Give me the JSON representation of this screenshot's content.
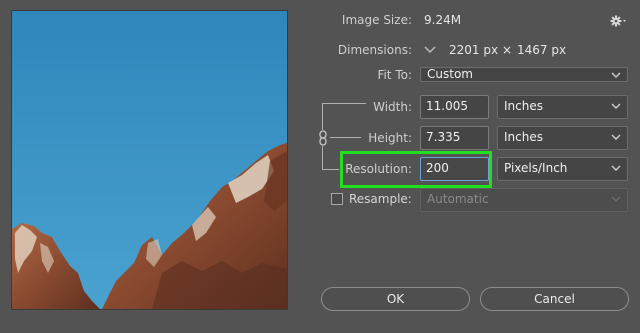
{
  "image_size": {
    "label": "Image Size:",
    "value": "9.24M"
  },
  "dimensions": {
    "label": "Dimensions:",
    "width": "2201 px",
    "times": "×",
    "height": "1467 px"
  },
  "fit_to": {
    "label": "Fit To:",
    "value": "Custom"
  },
  "width": {
    "label": "Width:",
    "value": "11.005",
    "unit": "Inches"
  },
  "height": {
    "label": "Height:",
    "value": "7.335",
    "unit": "Inches"
  },
  "resolution": {
    "label": "Resolution:",
    "value": "200",
    "unit": "Pixels/Inch"
  },
  "resample": {
    "label": "Resample:",
    "value": "Automatic",
    "checked": false
  },
  "buttons": {
    "ok": "OK",
    "cancel": "Cancel"
  },
  "icons": {
    "settings": "gear-icon",
    "constrain": "link-icon",
    "dimensions_dropdown": "chevron-down-icon"
  },
  "colors": {
    "highlight": "#21e021",
    "sky": "#3d92c2",
    "panel": "#535353"
  }
}
